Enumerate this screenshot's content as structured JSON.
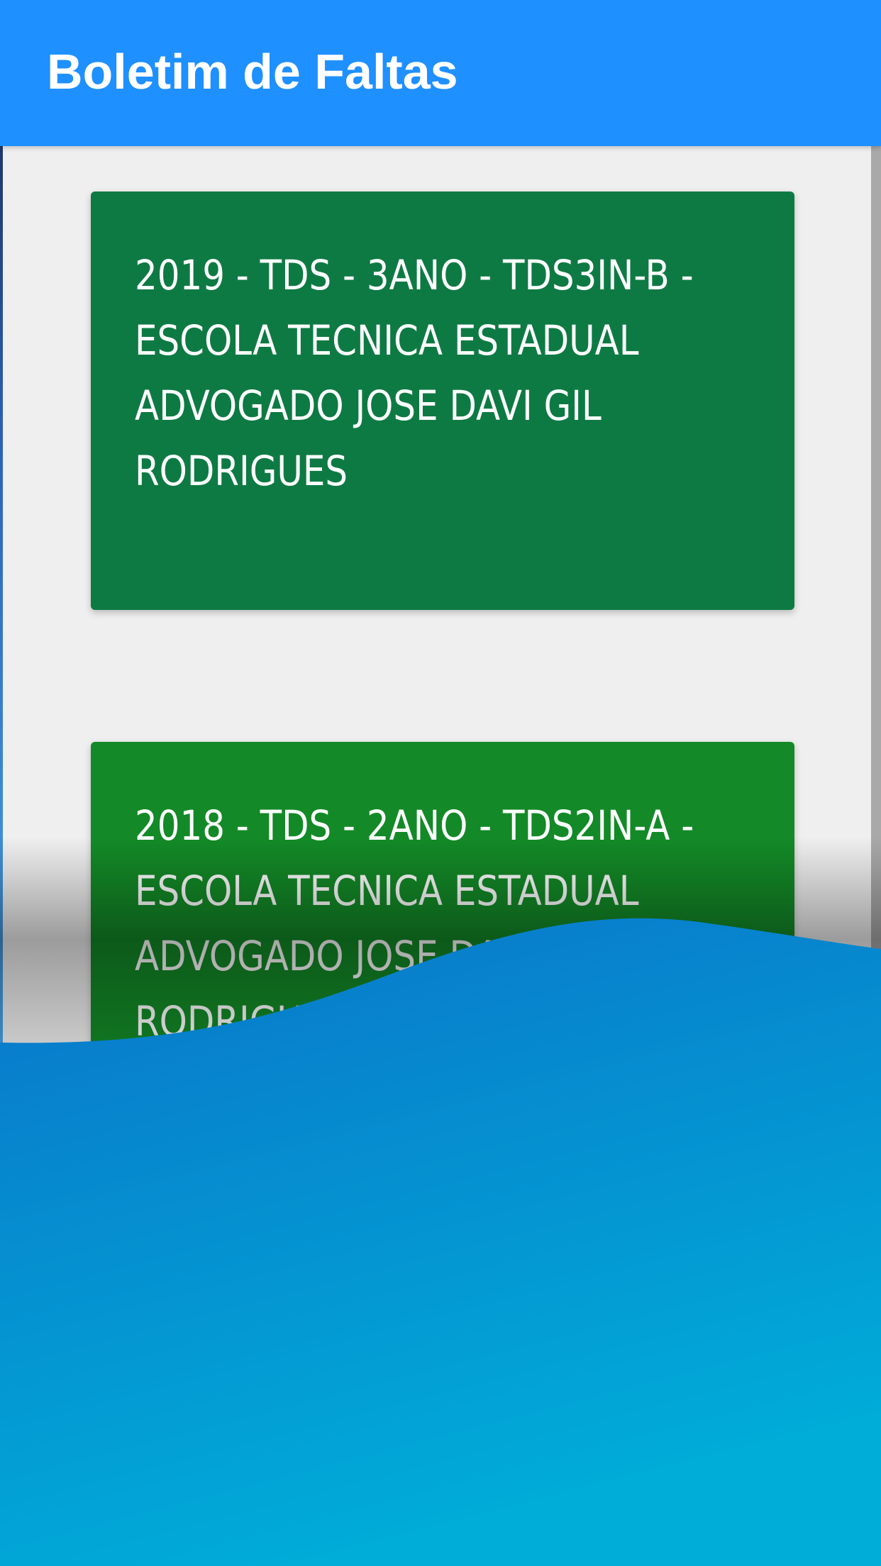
{
  "appbar": {
    "title": "Boletim de Faltas",
    "color": "#1e90ff"
  },
  "classes": [
    {
      "label": "2019 - TDS - 3ANO - TDS3IN-B - ESCOLA TECNICA ESTADUAL ADVOGADO JOSE DAVI GIL RODRIGUES",
      "color": "#0e7a43"
    },
    {
      "label": "2018 - TDS - 2ANO - TDS2IN-A - ESCOLA TECNICA ESTADUAL ADVOGADO JOSE DAVI GIL RODRIGUES",
      "color": "#138a27"
    }
  ],
  "overlay": {
    "wave_color_top": "#0a74c9",
    "wave_color_bottom": "#00acd8"
  }
}
